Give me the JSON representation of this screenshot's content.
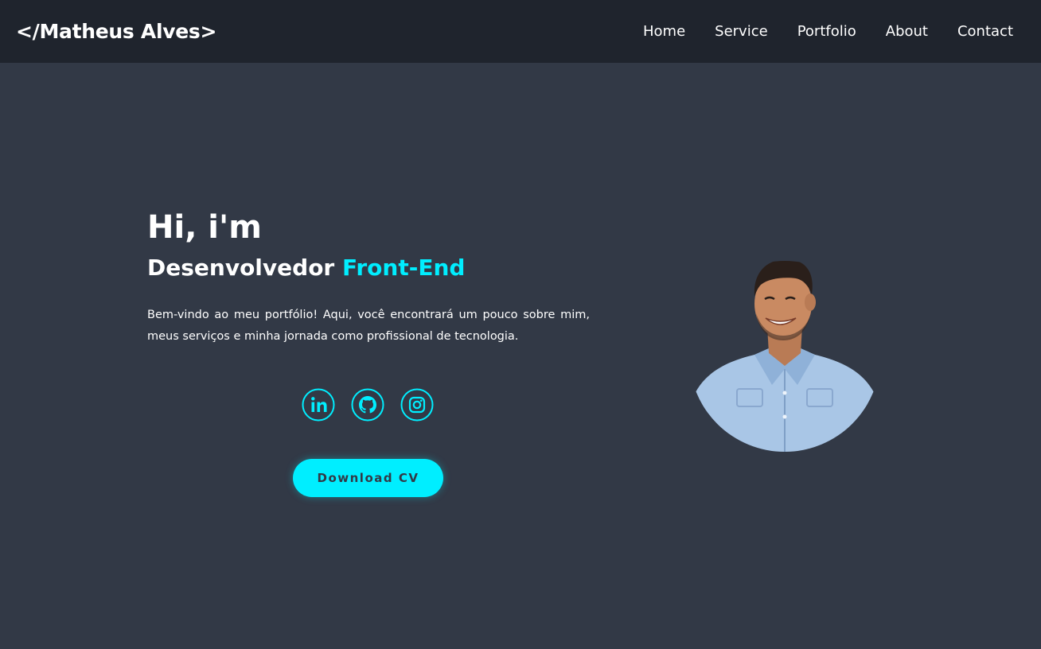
{
  "header": {
    "logo": "</Matheus Alves>",
    "nav": [
      "Home",
      "Service",
      "Portfolio",
      "About",
      "Contact"
    ]
  },
  "hero": {
    "greeting": "Hi, i'm",
    "role_prefix": "Desenvolvedor",
    "role_highlight": "Front-End",
    "intro": "Bem-vindo ao meu portfólio! Aqui, você encontrará um pouco sobre mim, meus serviços e minha jornada como profissional de tecnologia.",
    "social_icons": [
      "linkedin-icon",
      "github-icon",
      "instagram-icon"
    ],
    "cv_button": "Download CV"
  },
  "colors": {
    "background": "#323946",
    "header_background": "#1f242d",
    "accent": "#00eeff",
    "text": "#ffffff"
  }
}
